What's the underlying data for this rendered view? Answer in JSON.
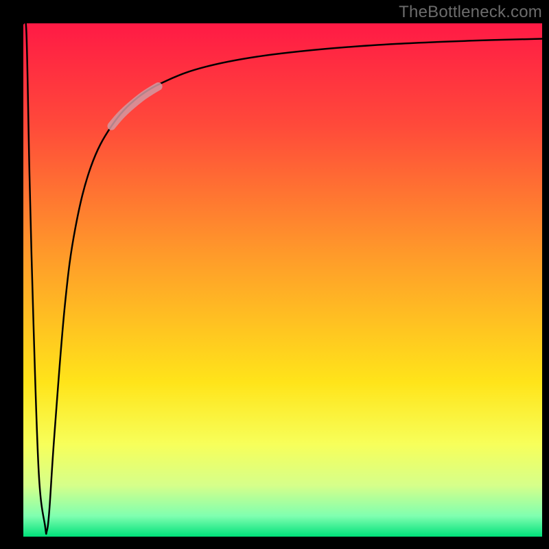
{
  "watermark": "TheBottleneck.com",
  "chart_data": {
    "type": "line",
    "title": "",
    "xlabel": "",
    "ylabel": "",
    "xlim": [
      0,
      100
    ],
    "ylim": [
      0,
      100
    ],
    "background_gradient": {
      "stops": [
        {
          "offset": 0.0,
          "color": "#ff1a45"
        },
        {
          "offset": 0.2,
          "color": "#ff4a3a"
        },
        {
          "offset": 0.45,
          "color": "#ff9a2a"
        },
        {
          "offset": 0.7,
          "color": "#ffe41a"
        },
        {
          "offset": 0.82,
          "color": "#f7ff5a"
        },
        {
          "offset": 0.9,
          "color": "#d6ff8a"
        },
        {
          "offset": 0.96,
          "color": "#7fffb0"
        },
        {
          "offset": 1.0,
          "color": "#00e07a"
        }
      ]
    },
    "borders_color": "#000000",
    "series": [
      {
        "name": "bottleneck-curve",
        "x": [
          0.0,
          0.6,
          1.2,
          2.0,
          3.0,
          4.2,
          4.5,
          5.0,
          6.0,
          8.0,
          10.0,
          13.0,
          17.0,
          22.0,
          28.0,
          35.0,
          45.0,
          58.0,
          72.0,
          86.0,
          100.0
        ],
        "y": [
          100.0,
          98.0,
          70.0,
          40.0,
          12.0,
          2.0,
          1.0,
          5.0,
          20.0,
          45.0,
          60.0,
          72.0,
          80.0,
          85.5,
          89.0,
          91.5,
          93.5,
          95.0,
          96.0,
          96.6,
          97.0
        ],
        "color": "#000000",
        "width": 2.5
      },
      {
        "name": "highlight-segment",
        "x": [
          17.0,
          18.5,
          20.0,
          21.5,
          23.0,
          24.5,
          26.0
        ],
        "y": [
          80.0,
          81.8,
          83.3,
          84.6,
          85.8,
          86.8,
          87.7
        ],
        "color": "#d29aa2",
        "width": 12
      }
    ]
  }
}
